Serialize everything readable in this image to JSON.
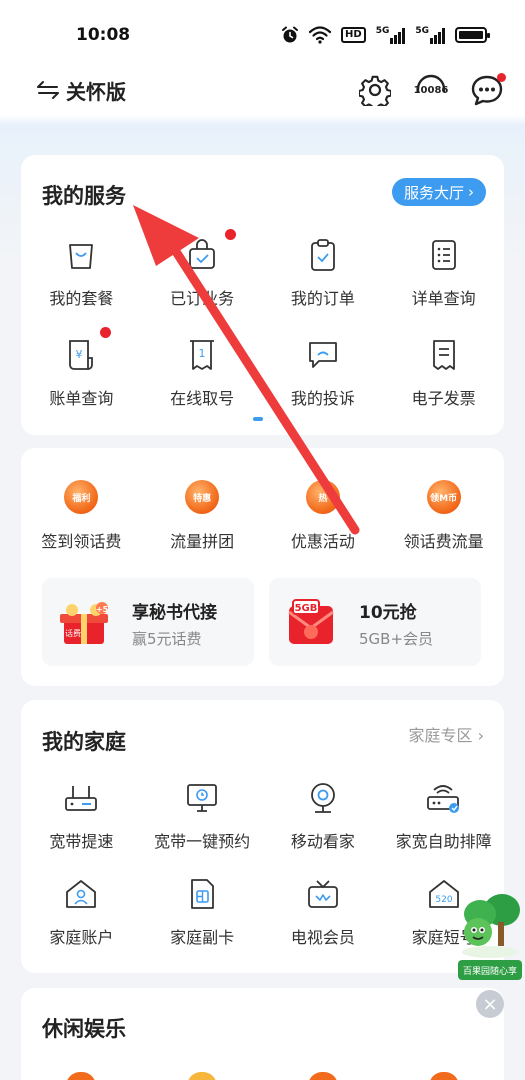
{
  "status_bar": {
    "time": "10:08",
    "hd_label": "HD",
    "sim1": "5G",
    "sim2": "5G"
  },
  "header": {
    "care_mode_label": "关怀版",
    "hotline_label": "10086"
  },
  "my_services": {
    "title": "我的服务",
    "hall_link": "服务大厅",
    "items": [
      {
        "label": "我的套餐",
        "icon": "shopping-bag-icon"
      },
      {
        "label": "已订业务",
        "icon": "subscribed-bag-icon"
      },
      {
        "label": "我的订单",
        "icon": "clipboard-check-icon"
      },
      {
        "label": "详单查询",
        "icon": "list-document-icon"
      },
      {
        "label": "账单查询",
        "icon": "yuan-bill-icon"
      },
      {
        "label": "在线取号",
        "icon": "queue-ticket-icon"
      },
      {
        "label": "我的投诉",
        "icon": "complaint-chat-icon"
      },
      {
        "label": "电子发票",
        "icon": "invoice-icon"
      }
    ]
  },
  "promotions": {
    "items": [
      {
        "label": "签到领话费",
        "badge": "福利"
      },
      {
        "label": "流量拼团",
        "badge": "特惠"
      },
      {
        "label": "优惠活动",
        "badge": "热"
      },
      {
        "label": "领话费流量",
        "badge": "领M币"
      }
    ],
    "boxes": [
      {
        "title": "享秘书代接",
        "subtitle": "赢5元话费",
        "badge": "+5",
        "badge_sub": "话费"
      },
      {
        "title": "10元抢",
        "subtitle": "5GB+会员",
        "badge": "5GB"
      }
    ]
  },
  "my_family": {
    "title": "我的家庭",
    "zone_link": "家庭专区",
    "items": [
      {
        "label": "宽带提速",
        "icon": "router-icon"
      },
      {
        "label": "宽带一键预约",
        "icon": "monitor-clock-icon"
      },
      {
        "label": "移动看家",
        "icon": "webcam-icon"
      },
      {
        "label": "家宽自助排障",
        "icon": "router-wifi-icon"
      },
      {
        "label": "家庭账户",
        "icon": "home-user-icon"
      },
      {
        "label": "家庭副卡",
        "icon": "sim-card-icon"
      },
      {
        "label": "电视会员",
        "icon": "tv-icon"
      },
      {
        "label": "家庭短号",
        "icon": "home-520-icon"
      }
    ]
  },
  "leisure": {
    "title": "休闲娱乐"
  },
  "floating_ad": {
    "label": "百果园随心享"
  },
  "colors": {
    "accent": "#3d9cf0",
    "badge_red": "#e8232b",
    "promo_orange": "#f26a1b",
    "annotation_red": "#ee3b3b"
  }
}
